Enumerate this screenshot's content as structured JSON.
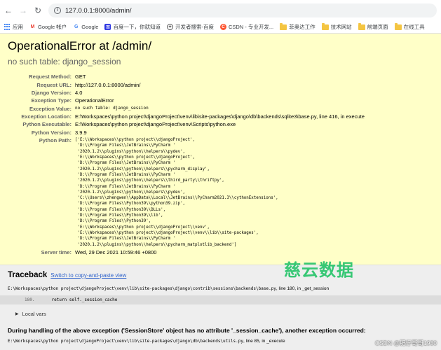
{
  "browser": {
    "url": "127.0.0.1:8000/admin/",
    "bookmarks": [
      {
        "label": "应用",
        "icon": "apps-grid-icon"
      },
      {
        "label": "Google 帐户",
        "icon": "gmail-icon"
      },
      {
        "label": "Google",
        "icon": "google-icon"
      },
      {
        "label": "百度一下，你就知道",
        "icon": "baidu-icon"
      },
      {
        "label": "开发者搜索-百度",
        "icon": "developer-search-icon"
      },
      {
        "label": "CSDN - 专业开发...",
        "icon": "csdn-icon"
      },
      {
        "label": "菲奥达工作",
        "icon": "folder-icon"
      },
      {
        "label": "技术网站",
        "icon": "folder-icon"
      },
      {
        "label": "前端页面",
        "icon": "folder-icon"
      },
      {
        "label": "在线工具",
        "icon": "folder-icon"
      }
    ]
  },
  "error": {
    "title": "OperationalError at /admin/",
    "subtitle": "no such table: django_session",
    "meta": [
      {
        "label": "Request Method:",
        "value": "GET"
      },
      {
        "label": "Request URL:",
        "value": "http://127.0.0.1:8000/admin/"
      },
      {
        "label": "Django Version:",
        "value": "4.0"
      },
      {
        "label": "Exception Type:",
        "value": "OperationalError"
      },
      {
        "label": "Exception Value:",
        "value": "no such table: django_session"
      },
      {
        "label": "Exception Location:",
        "value": "E:\\Workspaces\\python project\\djangoProject\\venv\\lib\\site-packages\\django\\db\\backends\\sqlite3\\base.py, line 416, in execute"
      },
      {
        "label": "Python Executable:",
        "value": "E:\\Workspaces\\python project\\djangoProject\\venv\\Scripts\\python.exe"
      },
      {
        "label": "Python Version:",
        "value": "3.9.9"
      }
    ],
    "python_path_label": "Python Path:",
    "python_path": [
      "['E:\\\\Workspaces\\\\python project\\\\djangoProject',",
      " 'D:\\\\Program Files\\\\JetBrains\\\\PyCharm '",
      " '2020.1.2\\\\plugins\\\\python\\\\helpers\\\\pydev',",
      " 'E:\\\\Workspaces\\\\python project\\\\djangoProject',",
      " 'D:\\\\Program Files\\\\JetBrains\\\\PyCharm '",
      " '2020.1.2\\\\plugins\\\\python\\\\helpers\\\\pycharm_display',",
      " 'D:\\\\Program Files\\\\JetBrains\\\\PyCharm '",
      " '2020.1.2\\\\plugins\\\\python\\\\helpers\\\\third_party\\\\thriftpy',",
      " 'D:\\\\Program Files\\\\JetBrains\\\\PyCharm '",
      " '2020.1.2\\\\plugins\\\\python\\\\helpers\\\\pydev',",
      " 'C:\\\\Users\\\\zhengwen\\\\AppData\\\\Local\\\\JetBrains\\\\PyCharm2021.3\\\\cythonExtensions',",
      " 'D:\\\\Program Files\\\\Python39\\\\python39.zip',",
      " 'D:\\\\Program Files\\\\Python39\\\\DLLs',",
      " 'D:\\\\Program Files\\\\Python39\\\\lib',",
      " 'D:\\\\Program Files\\\\Python39',",
      " 'E:\\\\Workspaces\\\\python project\\\\djangoProject\\\\venv',",
      " 'E:\\\\Workspaces\\\\python project\\\\djangoProject\\\\venv\\\\lib\\\\site-packages',",
      " 'D:\\\\Program Files\\\\JetBrains\\\\PyCharm '",
      " '2020.1.2\\\\plugins\\\\python\\\\helpers\\\\pycharm_matplotlib_backend']"
    ],
    "server_time_label": "Server time:",
    "server_time": "Wed, 29 Dec 2021 10:59:46 +0800"
  },
  "traceback": {
    "title": "Traceback",
    "switch_link": "Switch to copy-and-paste view",
    "frame1_file": "E:\\Workspaces\\python project\\djangoProject\\venv\\lib\\site-packages\\django\\contrib\\sessions\\backends\\base.py",
    "frame1_loc": ", line 180, in _get_session",
    "frame1_line_num": "180.",
    "frame1_code": "return self._session_cache",
    "local_vars": "Local vars",
    "during": "During handling of the above exception ('SessionStore' object has no attribute '_session_cache'), another exception occurred:",
    "frame2_file": "E:\\Workspaces\\python project\\djangoProject\\venv\\lib\\site-packages\\django\\db\\backends\\utils.py",
    "frame2_loc": ", line 85, in _execute"
  },
  "overlay": {
    "watermark": "慈云数据",
    "credit": "CSDN @肥仔哥哥1930"
  },
  "colors": {
    "summary_bg": "#ffffc8",
    "traceback_bg": "#eeeeee",
    "watermark": "#27c46a",
    "link": "#3366cc"
  }
}
